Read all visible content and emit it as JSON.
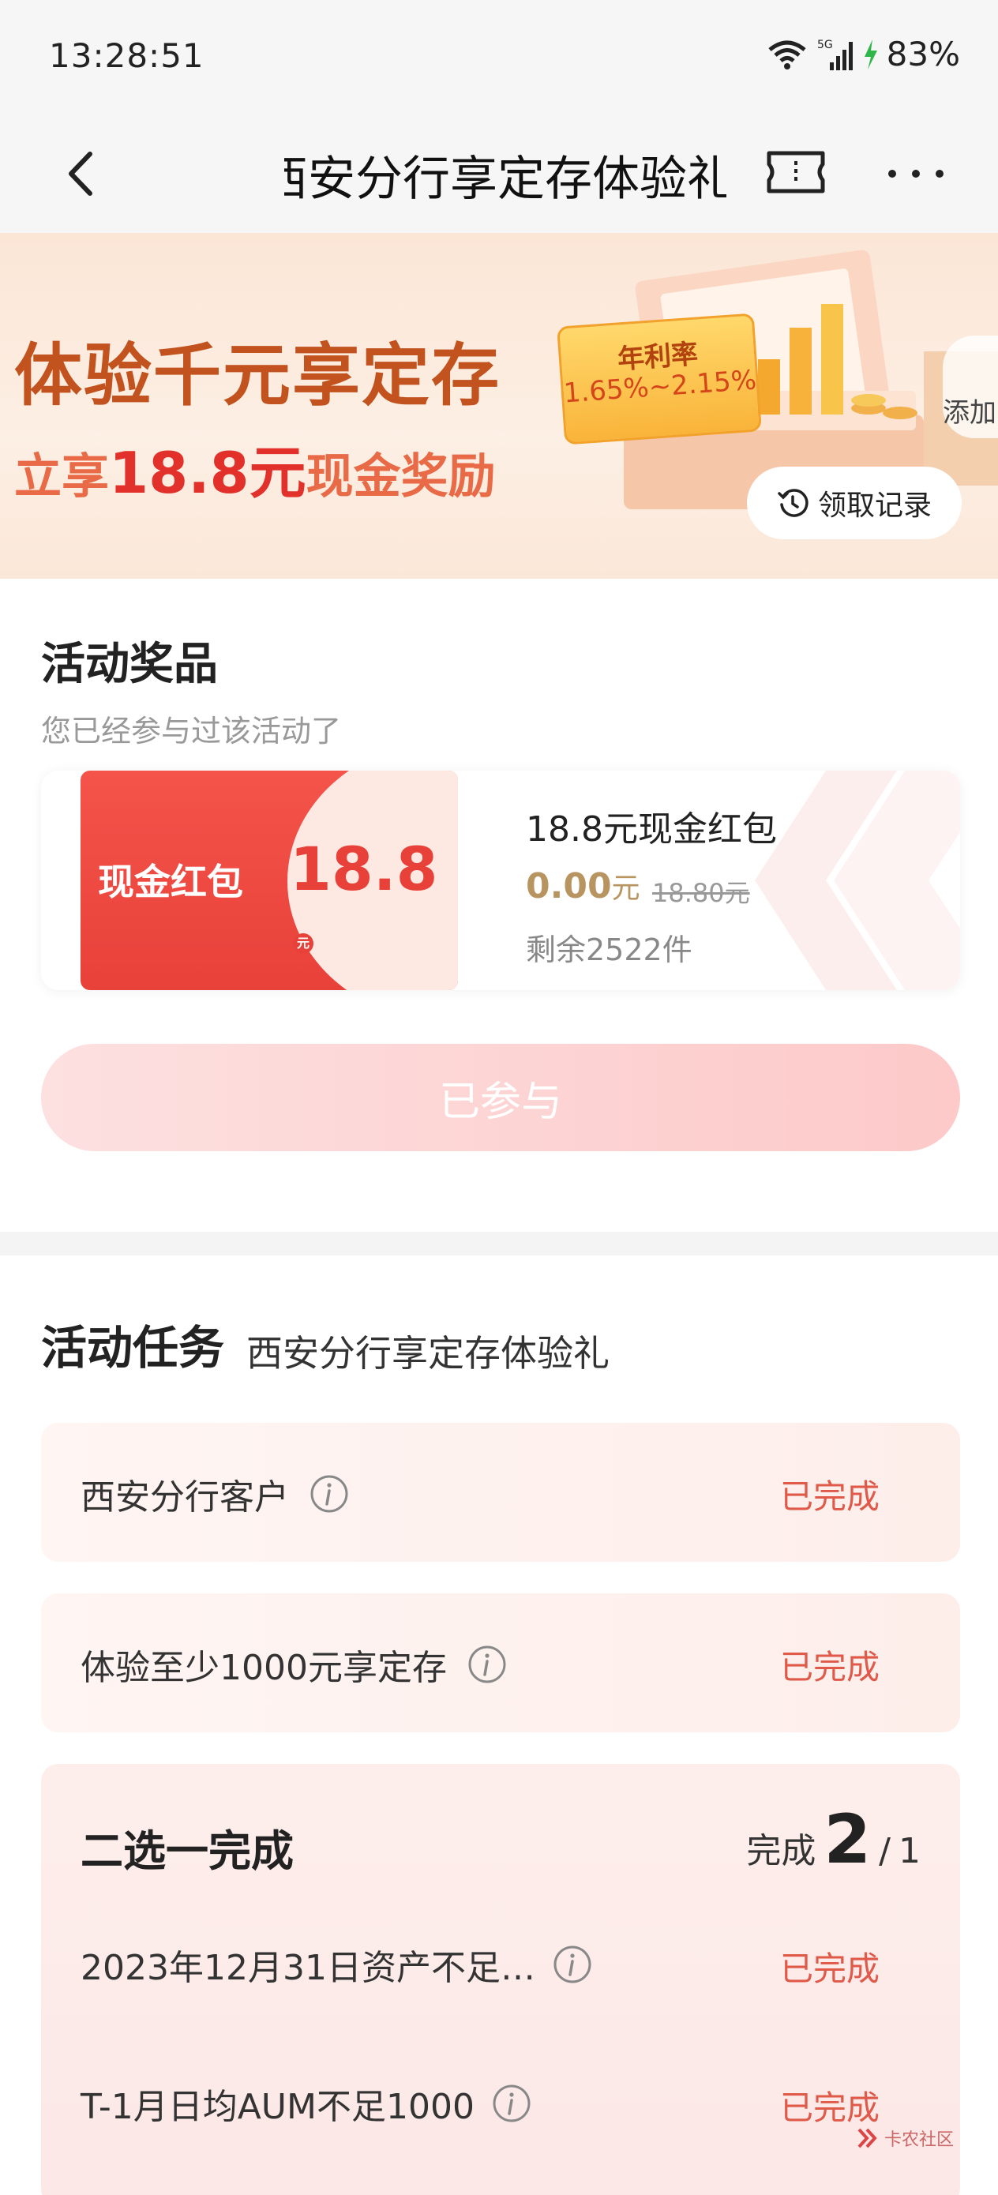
{
  "status_bar": {
    "time": "13:28:51",
    "network": "5G",
    "battery": "83%",
    "icons": [
      "wifi-icon",
      "cell-signal-icon",
      "charging-icon"
    ]
  },
  "nav": {
    "title": "西安分行享定存体验礼",
    "icons": [
      "back-icon",
      "ticket-icon",
      "more-icon"
    ]
  },
  "banner": {
    "headline": "体验千元享定存",
    "sub_prefix": "立享",
    "sub_amount": "18.8元",
    "sub_suffix": "现金奖励",
    "rate_label": "年利率",
    "rate_value": "1.65%~2.15%",
    "add_label": "添加",
    "record_label": "领取记录"
  },
  "prize": {
    "section_title": "活动奖品",
    "subtitle": "您已经参与过该活动了",
    "coupon_label": "现金红包",
    "coupon_amount": "18.8",
    "coupon_unit": "元",
    "name": "18.8元现金红包",
    "price": "0.00",
    "price_unit": "元",
    "original_price": "18.80元",
    "stock": "剩余2522件",
    "joined_button": "已参与"
  },
  "tasks": {
    "section_title": "活动任务",
    "section_sub": "西安分行享定存体验礼",
    "items": [
      {
        "label": "西安分行客户",
        "status": "已完成"
      },
      {
        "label": "体验至少1000元享定存",
        "status": "已完成"
      }
    ],
    "group": {
      "title": "二选一完成",
      "progress_label": "完成",
      "done": "2",
      "sep": "/",
      "total": "1",
      "items": [
        {
          "label": "2023年12月31日资产不足…",
          "status": "已完成"
        },
        {
          "label": "T-1月日均AUM不足1000",
          "status": "已完成"
        }
      ]
    }
  },
  "watermark": "卡农社区",
  "colors": {
    "accent_red": "#e8413a",
    "status_red": "#e05a4a",
    "banner_orange": "#c2521e",
    "price_gold": "#b89560"
  }
}
